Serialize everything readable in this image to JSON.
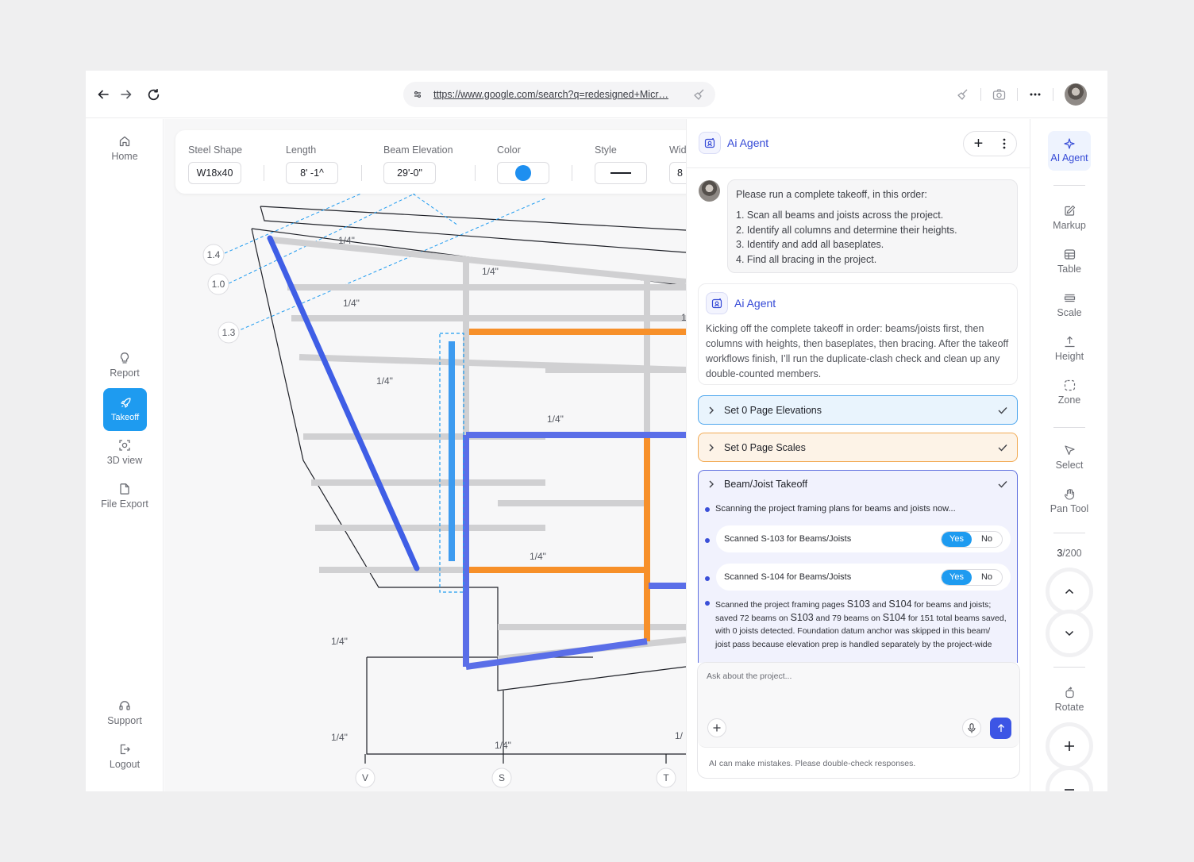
{
  "browser": {
    "url": "tttps://www.google.com/search?q=redesigned+Micr…"
  },
  "left_sidebar": {
    "items": [
      {
        "label": "Home",
        "icon": "home-icon"
      },
      {
        "label": "Report",
        "icon": "lightbulb-icon"
      },
      {
        "label": "Takeoff",
        "icon": "rocket-icon",
        "active": true
      },
      {
        "label": "3D view",
        "icon": "cube-view-icon"
      },
      {
        "label": "File Export",
        "icon": "file-export-icon"
      },
      {
        "label": "Support",
        "icon": "headset-icon"
      },
      {
        "label": "Logout",
        "icon": "logout-icon"
      }
    ]
  },
  "properties": {
    "steel_shape": {
      "label": "Steel Shape",
      "value": "W18x40"
    },
    "length": {
      "label": "Length",
      "value": "8' -1^"
    },
    "beam_elevation": {
      "label": "Beam Elevation",
      "value": "29'-0\""
    },
    "color": {
      "label": "Color",
      "value": "#1e8ff0"
    },
    "style": {
      "label": "Style"
    },
    "width": {
      "label": "Wid",
      "value": "8"
    }
  },
  "drawing": {
    "dimension_labels": [
      "1/4\"",
      "1/4\"",
      "1/4\"",
      "1/4\"",
      "1/4\"",
      "1/4\"",
      "1/4\"",
      "1/4\"",
      "1/4\"",
      "1/"
    ],
    "elevation_tags": [
      "1.4",
      "1.0",
      "1.3"
    ],
    "grid_tags": [
      "V",
      "S",
      "T"
    ],
    "clipped_label": "1"
  },
  "agent": {
    "title": "Ai Agent",
    "user_message": {
      "intro": "Please run a complete takeoff, in this order:",
      "steps": [
        "1. Scan all beams and joists across the project.",
        "2. Identify all columns and determine their heights.",
        "3. Identify and add all baseplates.",
        "4. Find all bracing in the project."
      ]
    },
    "reply": {
      "title": "Ai Agent",
      "text": "Kicking off the complete takeoff in order: beams/joists first, then columns with heights, then baseplates, then bracing. After the takeoff workflows finish, I’ll run the duplicate-clash check and clean up any double-counted members."
    },
    "workflows": [
      {
        "label": "Set 0 Page Elevations",
        "done": true
      },
      {
        "label": "Set 0 Page Scales",
        "done": true
      },
      {
        "label": "Beam/Joist Takeoff",
        "done": true
      }
    ],
    "beam_takeoff": {
      "status": "Scanning the project framing plans for beams and joists now...",
      "scans": [
        {
          "label": "Scanned S-103 for Beams/Joists",
          "yes": "Yes",
          "no": "No"
        },
        {
          "label": "Scanned S-104 for Beams/Joists",
          "yes": "Yes",
          "no": "No"
        }
      ],
      "summary": {
        "p1": "Scanned the project framing pages ",
        "s103": "S103",
        "p2": " and ",
        "s104": "S104",
        "p3": " for beams and joists;",
        "p4": "saved 72 beams on ",
        "s103b": "S103",
        "p5": " and 79 beams on ",
        "s104b": "S104",
        "p6": " for 151 total beams saved,",
        "p7": "with 0 joists detected. Foundation datum anchor was skipped in this beam/",
        "p8": "joist pass because elevation prep is handled separately by the project-wide"
      }
    },
    "composer": {
      "placeholder": "Ask about the project...",
      "disclaimer": "AI can make mistakes. Please double-check responses."
    }
  },
  "right_toolbar": {
    "items": [
      {
        "label": "AI Agent",
        "icon": "sparkle-icon",
        "active": true
      },
      {
        "label": "Markup",
        "icon": "pencil-icon"
      },
      {
        "label": "Table",
        "icon": "table-icon"
      },
      {
        "label": "Scale",
        "icon": "scale-icon"
      },
      {
        "label": "Height",
        "icon": "height-icon"
      },
      {
        "label": "Zone",
        "icon": "zone-icon"
      },
      {
        "label": "Select",
        "icon": "cursor-icon"
      },
      {
        "label": "Pan Tool",
        "icon": "hand-icon"
      },
      {
        "label": "Rotate",
        "icon": "rotate-icon"
      }
    ],
    "page": {
      "current": "3",
      "total": "/200"
    }
  },
  "colors": {
    "accent_blue": "#1e9bf0",
    "agent_indigo": "#3449d6",
    "beam_orange": "#f7902a",
    "beam_violet": "#5a6ee8",
    "beam_gray": "#d0d0d2"
  }
}
